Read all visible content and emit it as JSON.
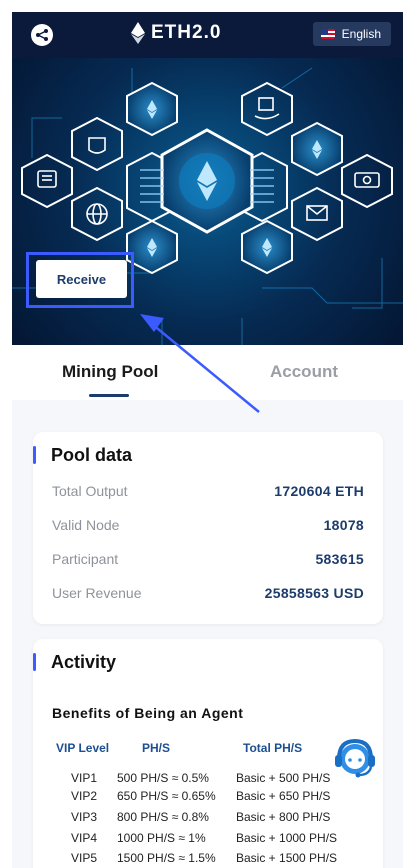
{
  "header": {
    "title": "ETH2.0",
    "language": "English",
    "share_icon": "share-icon",
    "brand_icon": "ethereum-icon",
    "flag_icon": "us-flag-icon"
  },
  "banner": {
    "receive_label": "Receive",
    "highlight_color": "#3b5bff"
  },
  "tabs": [
    {
      "label": "Mining Pool",
      "active": true
    },
    {
      "label": "Account",
      "active": false
    }
  ],
  "pool": {
    "title": "Pool data",
    "rows": [
      {
        "label": "Total Output",
        "value": "1720604 ETH"
      },
      {
        "label": "Valid Node",
        "value": "18078"
      },
      {
        "label": "Participant",
        "value": "583615"
      },
      {
        "label": "User Revenue",
        "value": "25858563 USD"
      }
    ]
  },
  "activity": {
    "title": "Activity",
    "subtitle": "Benefits of Being an Agent",
    "headers": [
      "VIP Level",
      "PH/S",
      "Total PH/S"
    ],
    "rows": [
      [
        "VIP1",
        "500 PH/S ≈ 0.5%",
        "Basic + 500 PH/S"
      ],
      [
        "VIP2",
        "650 PH/S ≈ 0.65%",
        "Basic + 650 PH/S"
      ],
      [
        "VIP3",
        "800 PH/S ≈ 0.8%",
        "Basic + 800 PH/S"
      ],
      [
        "VIP4",
        "1000 PH/S ≈ 1%",
        "Basic + 1000 PH/S"
      ],
      [
        "VIP5",
        "1500 PH/S ≈ 1.5%",
        "Basic + 1500 PH/S"
      ]
    ]
  },
  "support_icon": "customer-service-icon",
  "colors": {
    "accent": "#1d3c6c",
    "header_bg": "#0b1a3a",
    "label_gray": "#8e939b"
  }
}
